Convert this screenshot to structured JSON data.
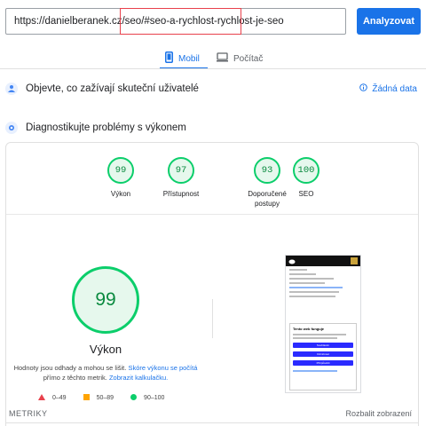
{
  "url_bar": {
    "value": "https://danielberanek.cz/seo/#seo-a-rychlost-rychlost-je-seo",
    "analyze_label": "Analyzovat"
  },
  "tabs": [
    {
      "label": "Mobil",
      "icon": "smartphone-icon",
      "active": true
    },
    {
      "label": "Počítač",
      "icon": "desktop-icon",
      "active": false
    }
  ],
  "field_data": {
    "title": "Objevte, co zažívají skuteční uživatelé",
    "no_data_label": "Žádná data",
    "icon": "users-icon"
  },
  "diagnostics": {
    "title": "Diagnostikujte problémy s výkonem",
    "icon": "lightning-icon"
  },
  "scores": [
    {
      "value": "99",
      "label": "Výkon"
    },
    {
      "value": "97",
      "label": "Přístupnost"
    },
    {
      "value": "93",
      "label": "Doporučené postupy"
    },
    {
      "value": "100",
      "label": "SEO"
    }
  ],
  "performance": {
    "score": "99",
    "label": "Výkon",
    "estimate_text_1": "Hodnoty jsou odhady a mohou se lišit.",
    "estimate_link_1": "Skóre výkonu se počítá",
    "estimate_text_2": "přímo z těchto metrik.",
    "estimate_link_2": "Zobrazit kalkulačku."
  },
  "legend": [
    {
      "range": "0–49",
      "shape": "triangle",
      "color": "#e8414c"
    },
    {
      "range": "50–89",
      "shape": "square",
      "color": "#ffa400"
    },
    {
      "range": "90–100",
      "shape": "circle",
      "color": "#0cce6b"
    }
  ],
  "phone_preview": {
    "modal_heading": "Tento web funguje",
    "buttons": [
      "Souhlasím",
      "Odmítnout",
      "Přizpůsobit"
    ]
  },
  "metrics": {
    "label": "METRIKY",
    "expand_label": "Rozbalit zobrazení"
  },
  "colors": {
    "accent": "#1a73e8",
    "pass": "#0cce6b",
    "average": "#ffa400",
    "fail": "#e8414c"
  }
}
